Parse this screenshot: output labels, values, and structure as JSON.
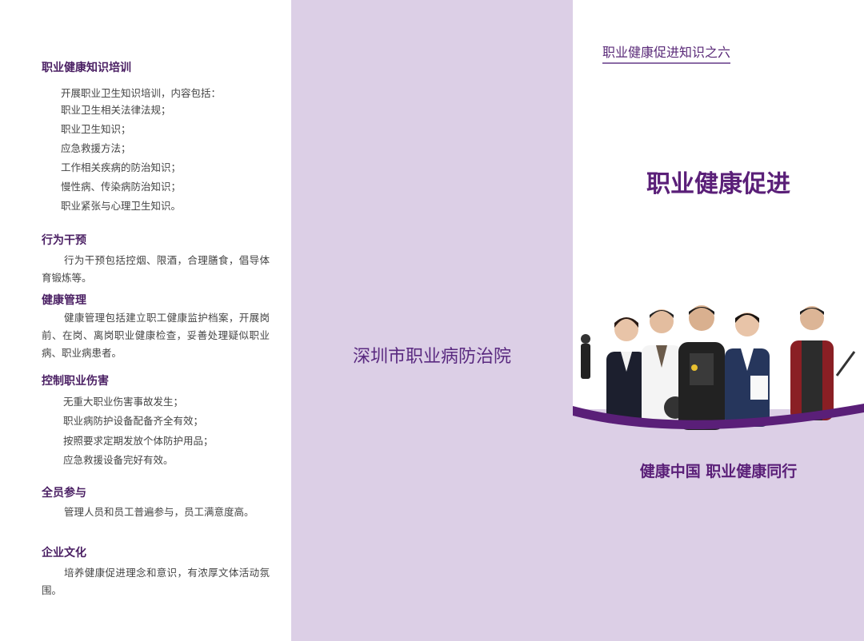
{
  "left": {
    "sections": [
      {
        "title": "职业健康知识培训",
        "intro": "开展职业卫生知识培训，内容包括：",
        "items": [
          "职业卫生相关法律法规；",
          "职业卫生知识；",
          "应急救援方法；",
          "工作相关疾病的防治知识；",
          "慢性病、传染病防治知识；",
          "职业紧张与心理卫生知识。"
        ]
      },
      {
        "title": "行为干预",
        "text": "行为干预包括控烟、限酒，合理膳食，倡导体育锻炼等。"
      },
      {
        "title": "健康管理",
        "text": "健康管理包括建立职工健康监护档案，开展岗前、在岗、离岗职业健康检查，妥善处理疑似职业病、职业病患者。"
      },
      {
        "title": "控制职业伤害",
        "items": [
          "无重大职业伤害事故发生；",
          "职业病防护设备配备齐全有效；",
          "按照要求定期发放个体防护用品；",
          "应急救援设备完好有效。"
        ]
      },
      {
        "title": "全员参与",
        "text": "管理人员和员工普遍参与，员工满意度高。"
      },
      {
        "title": "企业文化",
        "text": "培养健康促进理念和意识，有浓厚文体活动氛围。"
      }
    ]
  },
  "middle": {
    "institute": "深圳市职业病防治院"
  },
  "right": {
    "series": "职业健康促进知识之六",
    "title": "职业健康促进",
    "slogan": "健康中国 职业健康同行"
  },
  "colors": {
    "purple_dark": "#5a1f78",
    "lilac": "#dccfe6"
  }
}
